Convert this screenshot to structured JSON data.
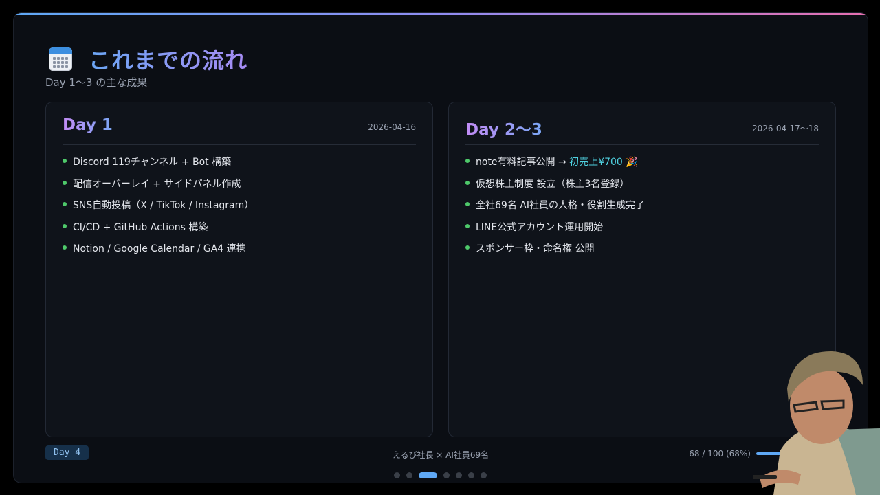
{
  "header": {
    "title": "これまでの流れ",
    "subtitle": "Day 1〜3 の主な成果",
    "icon": "calendar-icon"
  },
  "cards": [
    {
      "title": "Day 1",
      "date": "2026-04-16",
      "items": [
        "Discord 119チャンネル + Bot 構築",
        "配信オーバーレイ + サイドパネル作成",
        "SNS自動投稿（X / TikTok / Instagram）",
        "CI/CD + GitHub Actions 構築",
        "Notion / Google Calendar / GA4 連携"
      ]
    },
    {
      "title": "Day 2〜3",
      "date": "2026-04-17〜18",
      "items": [
        {
          "text": "note有料記事公開 → ",
          "highlight": "初売上¥700",
          "emoji": " 🎉"
        },
        "仮想株主制度 設立（株主3名登録）",
        "全社69名 AI社員の人格・役割生成完了",
        "LINE公式アカウント運用開始",
        "スポンサー枠・命名権 公開"
      ]
    }
  ],
  "footer": {
    "badge": "Day 4",
    "center": "えるび社長 × AI社員69名",
    "progress_text": "68 / 100 (68%)",
    "progress": 0.68
  },
  "nav": {
    "count": 7,
    "active": 2
  },
  "colors": {
    "accent": "#5fa8f5",
    "bullet": "#4ec96a",
    "highlight": "#4fd1e0",
    "background": "#0b0e14"
  }
}
